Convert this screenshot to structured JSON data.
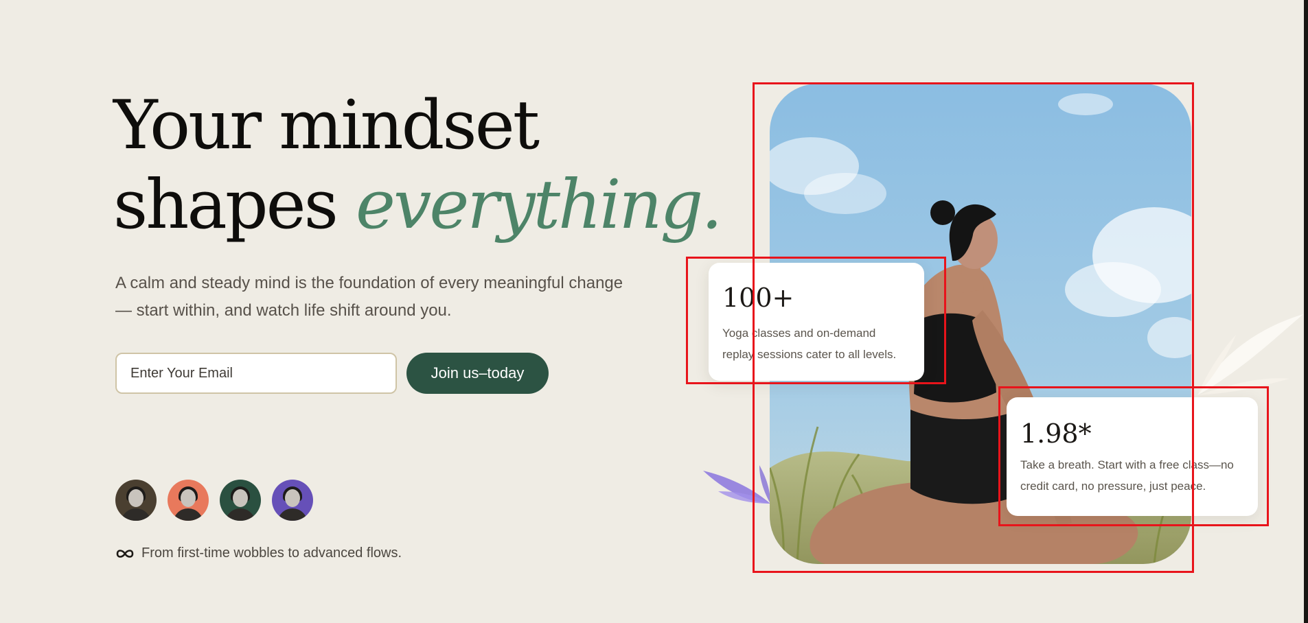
{
  "hero": {
    "title_line1": "Your mindset",
    "title_line2_plain": "shapes",
    "title_line2_accent": "everything.",
    "subtitle": "A calm and steady mind is the foundation of every meaningful change — start within, and watch life shift around you."
  },
  "signup": {
    "email_placeholder": "Enter Your Email",
    "button_label": "Join us–today"
  },
  "community": {
    "avatar_colors": [
      "#4a3f30",
      "#e8795c",
      "#2a5040",
      "#6650b8"
    ],
    "icon": "infinity-icon",
    "tagline": "From first-time wobbles to advanced flows."
  },
  "stats": [
    {
      "value": "100+",
      "description": "Yoga classes and on-demand replay sessions cater to all levels."
    },
    {
      "value": "1.98*",
      "description": "Take a breath. Start with a free class—no credit card, no pressure, just peace."
    }
  ],
  "colors": {
    "background": "#efece4",
    "accent_green": "#4d8468",
    "button_green": "#2c5343",
    "highlight_red": "#e8141b"
  }
}
